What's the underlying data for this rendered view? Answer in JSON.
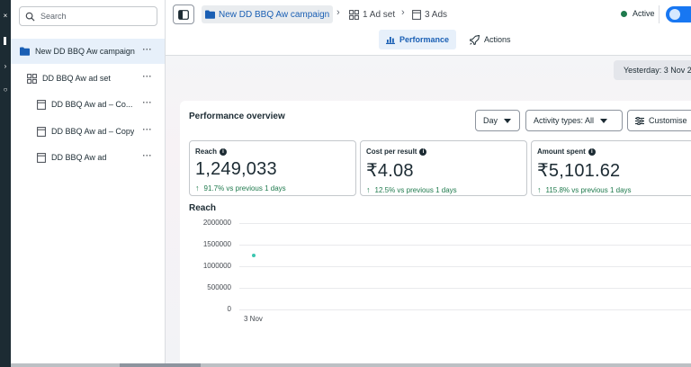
{
  "search": {
    "placeholder": "Search"
  },
  "tree": [
    {
      "label": "New DD BBQ Aw campaign",
      "type": "campaign",
      "selected": true
    },
    {
      "label": "DD BBQ Aw ad set",
      "type": "adset"
    },
    {
      "label": "DD BBQ Aw ad – Co...",
      "type": "ad"
    },
    {
      "label": "DD BBQ Aw ad – Copy",
      "type": "ad"
    },
    {
      "label": "DD BBQ Aw ad",
      "type": "ad"
    }
  ],
  "breadcrumb": {
    "campaign": "New DD BBQ Aw campaign",
    "adset": "1 Ad set",
    "ads": "3 Ads"
  },
  "status": {
    "label": "Active",
    "on": true
  },
  "tabs": {
    "performance": "Performance",
    "actions": "Actions"
  },
  "date_range": "Yesterday: 3 Nov 2",
  "overview": {
    "title": "Performance overview",
    "day_dropdown": "Day",
    "activity_dropdown": "Activity types: All",
    "customise_label": "Customise"
  },
  "metrics": [
    {
      "label": "Reach",
      "value": "1,249,033",
      "delta": "91.7% vs previous 1 days"
    },
    {
      "label": "Cost per result",
      "value": "₹4.08",
      "delta": "12.5% vs previous 1 days"
    },
    {
      "label": "Amount spent",
      "value": "₹5,101.62",
      "delta": "115.8% vs previous 1 days"
    }
  ],
  "chart_data": {
    "type": "scatter",
    "title": "Reach",
    "xlabel": "",
    "ylabel": "",
    "x": [
      "3 Nov"
    ],
    "series": [
      {
        "values": [
          1249033
        ]
      }
    ],
    "yticks": [
      "0",
      "500000",
      "1000000",
      "1500000",
      "2000000"
    ],
    "ylim": [
      0,
      2000000
    ],
    "colors": {
      "point": "#3cc6b0"
    }
  },
  "colors": {
    "accent": "#1877f2",
    "link": "#1a5fb4",
    "positive": "#1f7a4d"
  }
}
